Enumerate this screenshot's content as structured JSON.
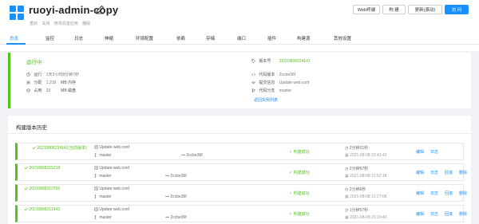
{
  "header": {
    "title": "ruoyi-admin-copy",
    "sub_links": [
      "重启",
      "关闭",
      "修改完善应用",
      "删除"
    ],
    "buttons": {
      "web_terminal": "Web终端",
      "build": "构 建",
      "update": "更新(滚动)",
      "visit": "访 问"
    }
  },
  "tabs": [
    "总览",
    "监控",
    "日志",
    "伸缩",
    "环境配置",
    "依赖",
    "存储",
    "端口",
    "插件",
    "构建源",
    "其他设置"
  ],
  "overview": {
    "status": "运行中",
    "runtime_label": "运行",
    "runtime_value": "1天3小时8分钟7秒",
    "alloc_label": "分配",
    "alloc_value": "1,216",
    "alloc_unit": "MB 内存",
    "used_label": "占用",
    "used_value": "33",
    "used_unit": "MB 磁盘",
    "version_label": "版本号",
    "version_value": "20210808224141",
    "code_version_label": "代码版本",
    "code_version_value": "2ccbe36f",
    "commit_label": "提交信息",
    "commit_value": "Update web.conf",
    "branch_label": "代码分支",
    "branch_value": "master",
    "rollback_link": "返回实例列表"
  },
  "history": {
    "title": "构建版本历史",
    "rows": [
      {
        "version": "20210808224141(当前版本)",
        "commit_msg": "Update web.conf",
        "branch": "master",
        "hash": "2ccbe36f",
        "status": "构建成功",
        "duration": "2分钟21秒",
        "time": "2021-08-08 22:41:42",
        "actions": [
          "编辑",
          "日志"
        ]
      },
      {
        "version": "20210808215218",
        "commit_msg": "Update web.conf",
        "branch": "master",
        "hash": "2ccbe36f",
        "status": "构建成功",
        "duration": "2分钟57秒",
        "time": "2021-08-08 21:52:18",
        "actions": [
          "编辑",
          "日志",
          "回滚",
          "删除"
        ]
      },
      {
        "version": "20210808212705",
        "commit_msg": "Update web.conf",
        "branch": "master",
        "hash": "2ccbe36f",
        "status": "构建成功",
        "duration": "2分钟6秒",
        "time": "2021-08-08 21:27:06",
        "actions": [
          "编辑",
          "日志",
          "回滚",
          "删除"
        ]
      },
      {
        "version": "20210808211943",
        "commit_msg": "Update web.conf",
        "branch": "master",
        "hash": "2ccbe36f",
        "status": "构建成功",
        "duration": "1分钟57秒",
        "time": "2021-08-08 21:19:43",
        "actions": [
          "编辑",
          "日志",
          "回滚",
          "删除"
        ]
      }
    ]
  },
  "colors": {
    "accent": "#1890ff",
    "success": "#52c41a"
  },
  "icons": [
    "app-logo-icon",
    "edit-icon",
    "clock-icon",
    "cpu-icon",
    "disk-icon",
    "tag-icon",
    "code-icon",
    "commit-icon",
    "branch-icon",
    "check-icon"
  ]
}
